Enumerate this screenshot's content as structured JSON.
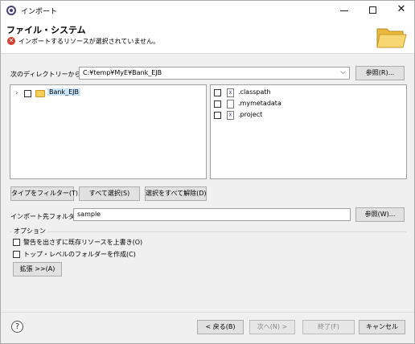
{
  "window": {
    "title": "インポート",
    "controls": {
      "minimize": "—",
      "maximize": "☐",
      "close": "✕"
    }
  },
  "banner": {
    "title": "ファイル・システム",
    "error_icon": "✕",
    "message": "インポートするリソースが選択されていません。"
  },
  "source": {
    "label": "次のディレクトリーから(Y):",
    "value": "C:¥temp¥MyE¥Bank_EJB",
    "dropdown_icon": "chevron-down-icon",
    "browse_label": "参照(R)..."
  },
  "tree": {
    "items": [
      {
        "label": "Bank_EJB",
        "expander": "›",
        "checked": false
      }
    ]
  },
  "files": {
    "items": [
      {
        "label": ".classpath",
        "icon": "X",
        "checked": false
      },
      {
        "label": ".mymetadata",
        "icon": "",
        "checked": false
      },
      {
        "label": ".project",
        "icon": "X",
        "checked": false
      }
    ]
  },
  "selection_buttons": {
    "filter": "タイプをフィルター(T)...",
    "select_all": "すべて選択(S)",
    "deselect_all": "選択をすべて解除(D)"
  },
  "destination": {
    "label": "インポート先フォルダ(L):",
    "value": "sample",
    "browse_label": "参照(W)..."
  },
  "options": {
    "title": "オプション",
    "items": [
      {
        "label": "警告を出さずに既存リソースを上書き(O)",
        "checked": false
      },
      {
        "label": "トップ・レベルのフォルダーを作成(C)",
        "checked": false
      }
    ],
    "advanced_label": "拡張 >>(A)"
  },
  "footer": {
    "help_icon": "?",
    "back": "< 戻る(B)",
    "next": "次へ(N) >",
    "finish": "終了(F)",
    "cancel": "キャンセル"
  }
}
